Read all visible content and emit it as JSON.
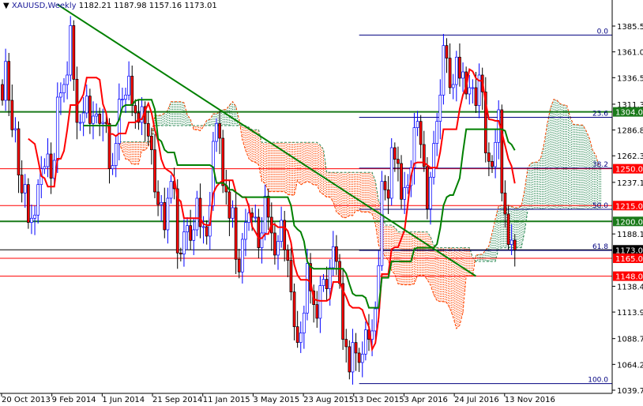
{
  "header": {
    "symbol": "XAUUSD,Weekly",
    "ohlc": "1182.21 1187.98 1157.16 1173.01",
    "menu_icon": "triangle-down-icon"
  },
  "chart_data": {
    "type": "candlestick",
    "title": "XAUUSD,Weekly",
    "ylim": [
      1039.7,
      1385.5
    ],
    "y_ticks": [
      "1385.50",
      "1361.00",
      "1336.50",
      "1311.30",
      "1286.80",
      "1262.30",
      "1237.10",
      "1188.10",
      "1138.40",
      "1113.90",
      "1088.70",
      "1064.20",
      "1039.70"
    ],
    "x_ticks": [
      "20 Oct 2013",
      "9 Feb 2014",
      "1 Jun 2014",
      "21 Sep 2014",
      "11 Jan 2015",
      "3 May 2015",
      "23 Aug 2015",
      "13 Dec 2015",
      "3 Apr 2016",
      "24 Jul 2016",
      "13 Nov 2016"
    ],
    "closes": [
      1315,
      1352,
      1315,
      1287,
      1288,
      1244,
      1227,
      1235,
      1199,
      1203,
      1206,
      1235,
      1250,
      1252,
      1264,
      1241,
      1258,
      1318,
      1322,
      1330,
      1339,
      1386,
      1335,
      1294,
      1294,
      1303,
      1319,
      1293,
      1300,
      1302,
      1293,
      1294,
      1293,
      1250,
      1253,
      1274,
      1316,
      1316,
      1320,
      1338,
      1310,
      1303,
      1294,
      1309,
      1293,
      1281,
      1268,
      1228,
      1216,
      1218,
      1192,
      1222,
      1238,
      1231,
      1170,
      1169,
      1190,
      1196,
      1182,
      1192,
      1222,
      1195,
      1195,
      1186,
      1215,
      1276,
      1293,
      1279,
      1234,
      1228,
      1203,
      1213,
      1164,
      1152,
      1183,
      1199,
      1208,
      1204,
      1204,
      1175,
      1189,
      1224,
      1204,
      1189,
      1168,
      1181,
      1201,
      1173,
      1163,
      1133,
      1100,
      1085,
      1094,
      1113,
      1160,
      1134,
      1121,
      1108,
      1139,
      1145,
      1136,
      1156,
      1176,
      1162,
      1141,
      1088,
      1081,
      1057,
      1085,
      1075,
      1066,
      1074,
      1097,
      1088,
      1096,
      1117,
      1158,
      1238,
      1230,
      1222,
      1270,
      1259,
      1255,
      1221,
      1232,
      1234,
      1251,
      1289,
      1295,
      1273,
      1252,
      1212,
      1242,
      1274,
      1295,
      1320,
      1367,
      1355,
      1327,
      1330,
      1356,
      1336,
      1342,
      1321,
      1327,
      1327,
      1310,
      1339,
      1323,
      1265,
      1257,
      1252,
      1275,
      1306,
      1227,
      1207,
      1178,
      1182.21,
      1173.01
    ],
    "last_candle": {
      "open": 1182.21,
      "high": 1187.98,
      "low": 1157.16,
      "close": 1173.01
    },
    "ichimoku": {
      "tenkan": 9,
      "kijun": 26,
      "senkou_b": 52,
      "shift": 26
    },
    "levels": [
      {
        "price": 1304.0,
        "label": "1304.00",
        "color": "#1a7a1a"
      },
      {
        "price": 1250.0,
        "label": "1250.00",
        "color": "#ff0000"
      },
      {
        "price": 1215.0,
        "label": "1215.00",
        "color": "#ff0000"
      },
      {
        "price": 1200.0,
        "label": "1200.00",
        "color": "#1a7a1a"
      },
      {
        "price": 1173.01,
        "label": "1173.01",
        "color": "#000000"
      },
      {
        "price": 1165.0,
        "label": "1165.00",
        "color": "#ff0000"
      },
      {
        "price": 1148.0,
        "label": "1148.00",
        "color": "#ff0000"
      }
    ],
    "fibonacci": {
      "high": 1377,
      "low": 1046,
      "start_week": 110,
      "levels": [
        {
          "ratio": 0.0,
          "label": "0.0"
        },
        {
          "ratio": 0.236,
          "label": "23.6"
        },
        {
          "ratio": 0.382,
          "label": "38.2"
        },
        {
          "ratio": 0.5,
          "label": "50.0"
        },
        {
          "ratio": 0.618,
          "label": "61.8"
        },
        {
          "ratio": 1.0,
          "label": "100.0"
        }
      ]
    },
    "trendline": {
      "from": {
        "week": 17,
        "price": 1406
      },
      "to": {
        "week": 146,
        "price": 1148
      }
    },
    "colors": {
      "up": "#0000ff",
      "down": "#ff0000",
      "tenkan": "#ff0000",
      "kijun": "#008000",
      "bear_cloud": "#ff4500",
      "bull_cloud": "#2e8b57",
      "fib": "#000080",
      "trend": "#008000"
    }
  }
}
